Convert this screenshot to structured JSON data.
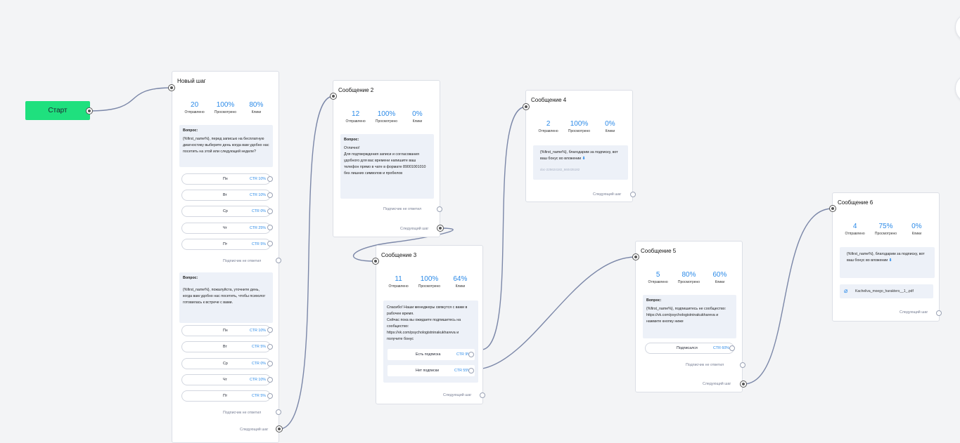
{
  "start": {
    "label": "Старт"
  },
  "labels": {
    "sent": "Отправлено",
    "viewed": "Просмотрено",
    "clicks": "Клики",
    "question": "Вопрос:",
    "no_reply": "Подписчик не ответил",
    "next_step": "Следующий шаг"
  },
  "n1": {
    "title": "Новый шаг",
    "stats": {
      "sent": "20",
      "viewed": "100%",
      "clicks": "80%"
    },
    "q1": {
      "text": "{%first_name%}, перед записью на бесплатную диагностику выберите день когда вам удобно нас посетить на этой или следующей неделе?",
      "options": [
        {
          "label": "Пн",
          "ctr": "CTR 10%"
        },
        {
          "label": "Вт",
          "ctr": "CTR 10%"
        },
        {
          "label": "Ср",
          "ctr": "CTR 0%"
        },
        {
          "label": "Чт",
          "ctr": "CTR 25%"
        },
        {
          "label": "Пт",
          "ctr": "CTR 5%"
        }
      ]
    },
    "q2": {
      "text": "{%first_name%}, пожалуйста, уточните день, когда вам удобно нас посетить, чтобы психолог готовилась к встрече с вами.",
      "options": [
        {
          "label": "Пн",
          "ctr": "CTR 10%"
        },
        {
          "label": "Вт",
          "ctr": "CTR 5%"
        },
        {
          "label": "Ср",
          "ctr": "CTR 0%"
        },
        {
          "label": "Чт",
          "ctr": "CTR 10%"
        },
        {
          "label": "Пт",
          "ctr": "CTR 5%"
        }
      ]
    }
  },
  "n2": {
    "title": "Сообщение 2",
    "stats": {
      "sent": "12",
      "viewed": "100%",
      "clicks": "0%"
    },
    "text": "Отлично!\nДля подтверждения записи и согласования удобного для вас времени напишите ваш\nтелефон прямо в чате в формате 89001001010 без лишних символов и пробелов"
  },
  "n3": {
    "title": "Сообщение 3",
    "stats": {
      "sent": "11",
      "viewed": "100%",
      "clicks": "64%"
    },
    "text": "Спасибо! Наши менеджеры свяжутся с вами в рабочее время.\nСейчас пока вы ожидаете подпишитесь на сообщество:\nhttps://vk.com/psychologistninakukhareva и получите бонус",
    "buttons": [
      {
        "label": "Есть подписка",
        "ctr": "CTR 9%"
      },
      {
        "label": "Нет подписки",
        "ctr": "CTR 55%"
      }
    ]
  },
  "n4": {
    "title": "Сообщение 4",
    "stats": {
      "sent": "2",
      "viewed": "100%",
      "clicks": "0%"
    },
    "text": "{%first_name%}, благодарим за подписку, вот ваш бонус во вложении",
    "doc": "doc-225624182_660435182"
  },
  "n5": {
    "title": "Сообщение 5",
    "stats": {
      "sent": "5",
      "viewed": "80%",
      "clicks": "60%"
    },
    "text": "{%first_name%}, подпишитесь не сообщество:\nhttps://vk.com/psychologistninakukhareva и нажмите кнопку ниже",
    "button": {
      "label": "Подписался",
      "ctr": "CTR 60%"
    }
  },
  "n6": {
    "title": "Сообщение 6",
    "stats": {
      "sent": "4",
      "viewed": "75%",
      "clicks": "0%"
    },
    "text": "{%first_name%}, благодарим за подписку, вот ваш бонус во вложении",
    "file": "Kacheliva_moego_harakters__1_.pdf"
  },
  "colors": {
    "accent": "#2b8ae8",
    "start": "#1fe07e",
    "edge": "#7b87a8",
    "canvas": "#f3f4f6"
  }
}
